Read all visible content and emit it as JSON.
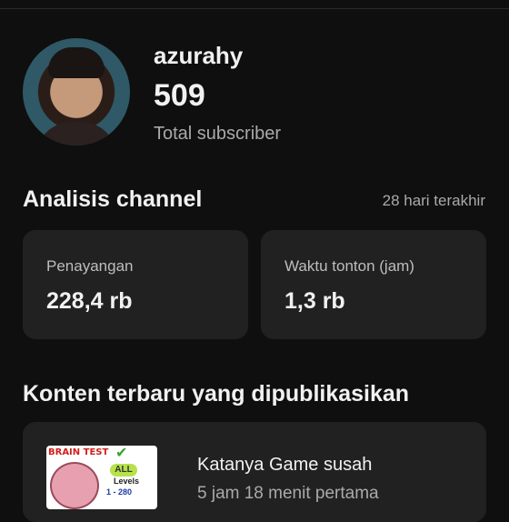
{
  "channel": {
    "name": "azurahy",
    "subscriber_count": "509",
    "subscriber_label": "Total subscriber"
  },
  "analytics": {
    "title": "Analisis channel",
    "range": "28 hari terakhir",
    "cards": [
      {
        "label": "Penayangan",
        "value": "228,4 rb"
      },
      {
        "label": "Waktu tonton (jam)",
        "value": "1,3 rb"
      }
    ]
  },
  "latest": {
    "title": "Konten terbaru yang dipublikasikan",
    "video": {
      "title": "Katanya Game susah",
      "meta": "5 jam 18 menit pertama",
      "thumbnail": {
        "heading": "BRAIN TEST",
        "badge": "ALL",
        "levels_label": "Levels",
        "levels_range": "1 - 280"
      }
    }
  }
}
